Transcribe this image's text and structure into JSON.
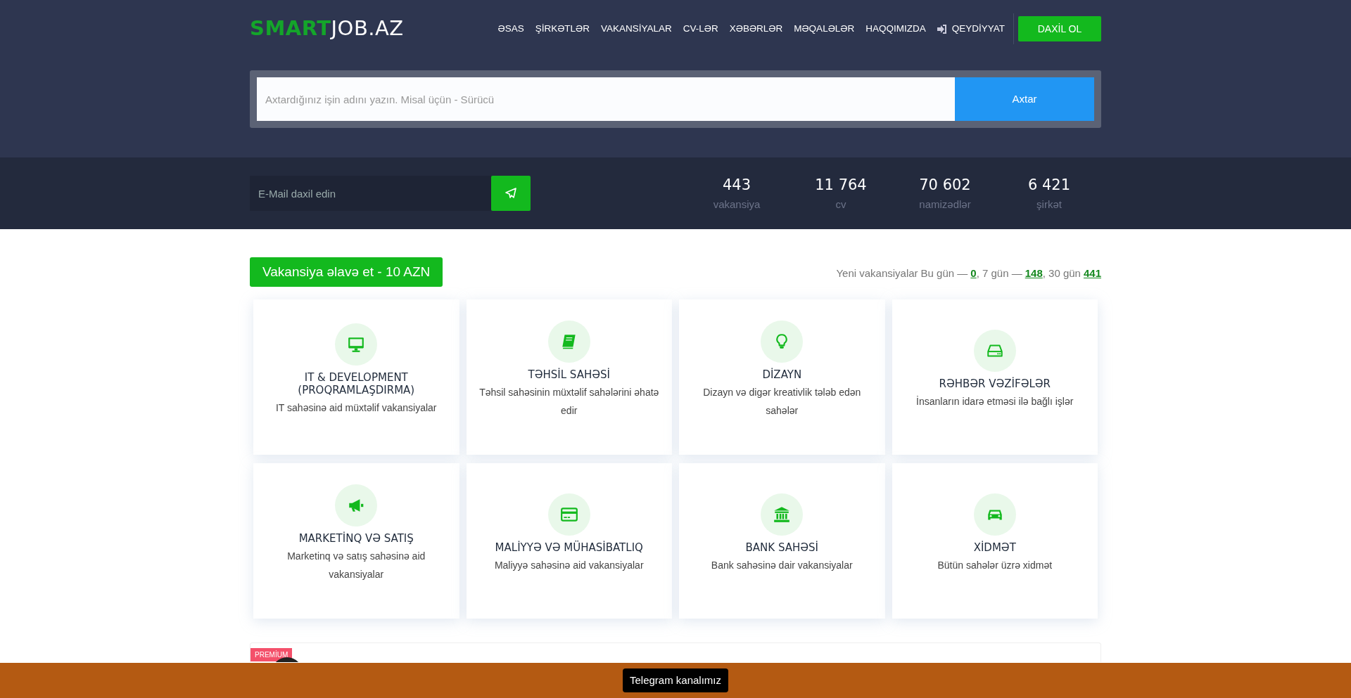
{
  "logo": {
    "brand": "SMART",
    "rest": "JOB.AZ"
  },
  "nav": [
    {
      "label": "ƏSAS",
      "kind": "link"
    },
    {
      "label": "ŞİRKƏTLƏR",
      "kind": "link"
    },
    {
      "label": "VAKANSİYALAR",
      "kind": "link"
    },
    {
      "label": "CV-LƏR",
      "kind": "link"
    },
    {
      "label": "XƏBƏRLƏR",
      "kind": "link"
    },
    {
      "label": "MƏQALƏLƏR",
      "kind": "link"
    },
    {
      "label": "HAQQIMIZDA",
      "kind": "link"
    },
    {
      "label": "QEYDİYYAT",
      "kind": "icon-link"
    }
  ],
  "login_button": "DAXİL OL",
  "search": {
    "placeholder": "Axtardığınız işin adını yazın. Misal üçün - Sürücü",
    "button": "Axtar"
  },
  "subscribe": {
    "placeholder": "E-Mail daxil edin"
  },
  "stats": [
    {
      "value": "443",
      "label": "vakansiya"
    },
    {
      "value": "11 764",
      "label": "cv"
    },
    {
      "value": "70 602",
      "label": "namizədlər"
    },
    {
      "value": "6 421",
      "label": "şirkət"
    }
  ],
  "add_vacancy_button": "Vakansiya əlavə et - 10 AZN",
  "new_vacancies": {
    "label": "Yeni vakansiyalar",
    "periods": [
      {
        "label": "Bu gün —",
        "count": "0"
      },
      {
        "label": ", 7 gün —",
        "count": "148"
      },
      {
        "label": ", 30 gün",
        "count": "441"
      }
    ]
  },
  "categories": [
    {
      "title": "IT & DEVELOPMENT (PROQRAMLAŞDIRMA)",
      "description": "IT sahəsinə aid müxtəlif vakansiyalar"
    },
    {
      "title": "TƏHSİL SAHƏSİ",
      "description": "Təhsil sahəsinin müxtəlif sahələrini əhatə edir"
    },
    {
      "title": "DİZAYN",
      "description": "Dizayn və digər kreativlik tələb edən sahələr"
    },
    {
      "title": "RƏHBƏR VƏZİFƏLƏR",
      "description": "İnsanların idarə etməsi ilə bağlı işlər"
    },
    {
      "title": "MARKETİNQ VƏ SATIŞ",
      "description": "Marketinq və satış sahəsinə aid vakansiyalar"
    },
    {
      "title": "MALİYYƏ VƏ MÜHASİBATLIQ",
      "description": "Maliyyə sahəsinə aid vakansiyalar"
    },
    {
      "title": "BANK SAHƏSİ",
      "description": "Bank sahəsinə dair vakansiyalar"
    },
    {
      "title": "XİDMƏT",
      "description": "Bütün sahələr üzrə xidmət"
    }
  ],
  "premium_listing": {
    "badge": "PREMİUM"
  },
  "telegram_button": "Telegram kanalımız"
}
